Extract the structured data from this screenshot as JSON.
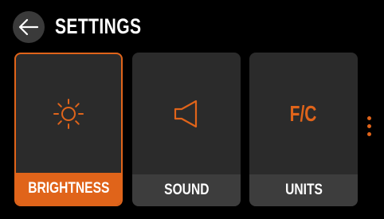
{
  "header": {
    "title": "SETTINGS",
    "back_icon": "arrow-left-icon"
  },
  "tiles": [
    {
      "label": "BRIGHTNESS",
      "icon": "sun-icon",
      "selected": true
    },
    {
      "label": "SOUND",
      "icon": "speaker-icon",
      "selected": false
    },
    {
      "label": "UNITS",
      "icon_text": "F/C",
      "selected": false
    }
  ],
  "more_icon": "vertical-dots-icon",
  "colors": {
    "accent": "#e0641a",
    "background": "#000000",
    "tile": "#2b2b2b",
    "tile_label": "#3d3d3d",
    "text": "#ffffff"
  }
}
